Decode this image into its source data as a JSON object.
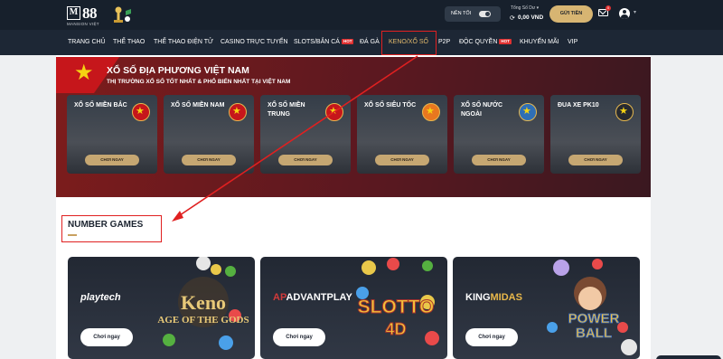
{
  "header": {
    "logo": {
      "mark": "M",
      "number": "88",
      "sub": "MANSION  VIỆT"
    },
    "dark_mode_label": "NỀN TỐI",
    "balance_label": "Tổng Số Dư ▾",
    "balance_value": "0,00 VND",
    "deposit_label": "GỬI TIỀN",
    "mail_count": "0"
  },
  "nav": {
    "items": [
      {
        "label": "TRANG CHỦ",
        "hot": ""
      },
      {
        "label": "THỂ THAO",
        "hot": ""
      },
      {
        "label": "THỂ THAO ĐIỆN TỬ",
        "hot": ""
      },
      {
        "label": "CASINO TRỰC TUYẾN",
        "hot": ""
      },
      {
        "label": "SLOTS/BẮN CÁ",
        "hot": "HOT"
      },
      {
        "label": "ĐÁ GÀ",
        "hot": ""
      },
      {
        "label": "KENO/XỔ SỐ",
        "hot": ""
      },
      {
        "label": "P2P",
        "hot": ""
      },
      {
        "label": "ĐỘC QUYỀN",
        "hot": "HOT"
      },
      {
        "label": "KHUYẾN MÃI",
        "hot": ""
      },
      {
        "label": "VIP",
        "hot": ""
      }
    ]
  },
  "lottery": {
    "title": "XỔ SỐ ĐỊA PHƯƠNG VIỆT NAM",
    "subtitle": "THỊ TRƯỜNG XỔ SỐ TỐT NHẤT & PHỔ BIẾN NHẤT TẠI VIỆT NAM",
    "cards": [
      {
        "name": "XỔ SỐ MIỀN BẮC",
        "button": "CHƠI NGAY"
      },
      {
        "name": "XỔ SỐ MIỀN NAM",
        "button": "CHƠI NGAY"
      },
      {
        "name": "XỔ SỐ MIỀN TRUNG",
        "button": "CHƠI NGAY"
      },
      {
        "name": "XỔ SỐ SIÊU TỐC",
        "button": "CHƠI NGAY"
      },
      {
        "name": "XỔ SỐ NƯỚC NGOÀI",
        "button": "CHƠI NGAY"
      },
      {
        "name": "ĐUA XE PK10",
        "button": "CHƠI NGAY"
      }
    ]
  },
  "number_games": {
    "title": "NUMBER GAMES",
    "games": [
      {
        "provider": "playtech",
        "art_text": "Keno",
        "art_sub": "AGE OF THE GODS",
        "button": "Chơi ngay"
      },
      {
        "provider_prefix": "AP",
        "provider": "ADVANTPLAY",
        "art_text": "SLOTTO",
        "art_sub": "4D",
        "button": "Chơi ngay"
      },
      {
        "provider_prefix": "KING",
        "provider": "MIDAS",
        "art_text": "POWER",
        "art_sub": "BALL",
        "button": "Chơi ngay"
      }
    ]
  },
  "colors": {
    "header_bg": "#17202c",
    "nav_bg": "#1d2735",
    "accent_gold": "#e2b96c",
    "annotation_red": "#e02020",
    "banner_red": "#7d1c1c"
  }
}
